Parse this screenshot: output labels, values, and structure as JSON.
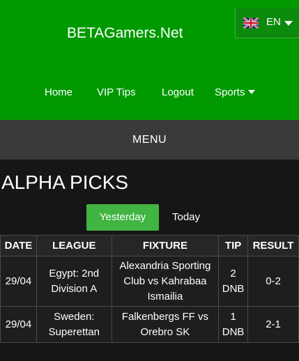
{
  "header": {
    "brand": "BETAGamers.Net",
    "language": {
      "code": "EN",
      "flag": "uk-flag-icon"
    }
  },
  "nav": {
    "items": [
      "Home",
      "VIP Tips",
      "Logout",
      "Sports"
    ]
  },
  "menu": {
    "label": "MENU"
  },
  "page": {
    "title": "ALPHA PICKS"
  },
  "tabs": [
    "Yesterday",
    "Today"
  ],
  "table": {
    "headers": [
      "DATE",
      "LEAGUE",
      "FIXTURE",
      "TIP",
      "RESULT"
    ],
    "rows": [
      {
        "date": "29/04",
        "league": "Egypt: 2nd Division A",
        "fixture": "Alexandria Sporting Club vs Kahrabaa Ismailia",
        "tip": "2 DNB",
        "result": "0-2"
      },
      {
        "date": "29/04",
        "league": "Sweden: Superettan",
        "fixture": "Falkenbergs FF vs Orebro SK",
        "tip": "1 DNB",
        "result": "2-1"
      }
    ]
  },
  "colors": {
    "header_green": "#009a00",
    "tab_active": "#41b441",
    "menubar": "#3a3a3a",
    "background": "#161616"
  }
}
